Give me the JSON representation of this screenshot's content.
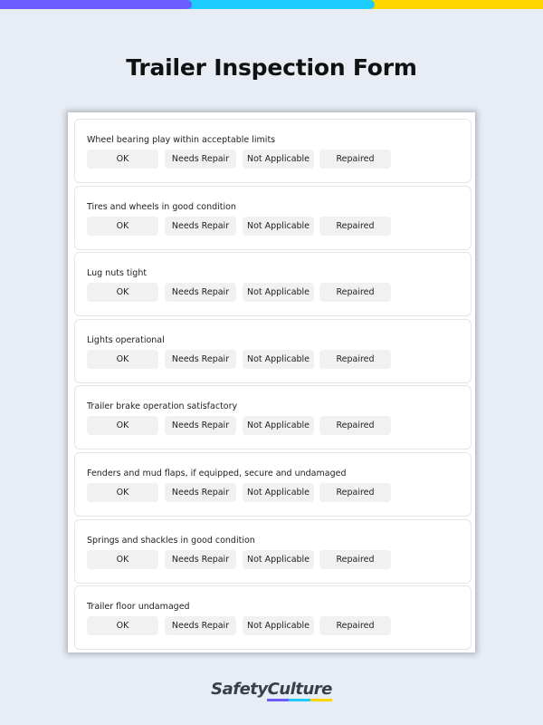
{
  "colors": {
    "bar_purple": "#6c5cff",
    "bar_cyan": "#1ccbff",
    "bar_yellow": "#ffd500"
  },
  "title": "Trailer Inspection Form",
  "options": [
    "OK",
    "Needs Repair",
    "Not Applicable",
    "Repaired"
  ],
  "items": [
    {
      "label": "Wheel bearing play within acceptable limits"
    },
    {
      "label": "Tires and wheels in good condition"
    },
    {
      "label": "Lug nuts tight"
    },
    {
      "label": "Lights operational"
    },
    {
      "label": "Trailer brake operation satisfactory"
    },
    {
      "label": "Fenders and mud flaps, if equipped, secure and undamaged"
    },
    {
      "label": "Springs and shackles in good condition"
    },
    {
      "label": "Trailer floor undamaged"
    }
  ],
  "brand": {
    "name": "SafetyCulture"
  }
}
